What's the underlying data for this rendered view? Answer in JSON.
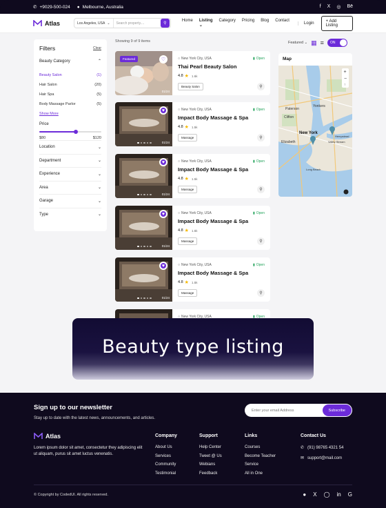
{
  "topbar": {
    "phone": "+9029-500-024",
    "location": "Melbourne, Australia",
    "socials": [
      "f",
      "X",
      "◎",
      "Bē"
    ]
  },
  "nav": {
    "brand": "Atlas",
    "search_location": "Los Angeles, USA",
    "search_placeholder": "Search property....",
    "menu": [
      "Home",
      "Listing",
      "Category",
      "Pricing",
      "Blog",
      "Contact"
    ],
    "login": "Login",
    "add_listing": "Add Listing"
  },
  "filters": {
    "title": "Filters",
    "clear": "Clear",
    "category_title": "Beauty Category",
    "categories": [
      {
        "label": "Beauty Salon",
        "count": "(1)"
      },
      {
        "label": "Hair Salon",
        "count": "(20)"
      },
      {
        "label": "Hair Spa",
        "count": "(5)"
      },
      {
        "label": "Body Massage Parlor",
        "count": "(5)"
      }
    ],
    "show_more": "Show More",
    "price_title": "Price",
    "price_min": "$80",
    "price_max": "$120",
    "price_level": 0.58,
    "sections": [
      "Location",
      "Department",
      "Experience",
      "Area",
      "Garage",
      "Type"
    ]
  },
  "results": {
    "showing": "Showing 9 of 9 items",
    "sort": "Featured",
    "map_toggle": "ON"
  },
  "listings": [
    {
      "featured": "Featured",
      "location": "New York City, USA",
      "status": "Open",
      "name": "Thai Pearl Beauty Salon",
      "rating": "4.8",
      "reviews": "1.6k",
      "tag": "Beauty Salon",
      "counter": "01/24"
    },
    {
      "location": "New York City, USA",
      "status": "Open",
      "name": "Impact Body Massage & Spa",
      "rating": "4.8",
      "reviews": "1.5k",
      "tag": "Massage",
      "counter": "01/24"
    },
    {
      "location": "New York City, USA",
      "status": "Open",
      "name": "Impact Body Massage & Spa",
      "rating": "4.8",
      "reviews": "1.5k",
      "tag": "Massage",
      "counter": "01/24"
    },
    {
      "location": "New York City, USA",
      "status": "Open",
      "name": "Impact Body Massage & Spa",
      "rating": "4.8",
      "reviews": "1.5k",
      "tag": "Massage",
      "counter": "01/24"
    },
    {
      "location": "New York City, USA",
      "status": "Open",
      "name": "Impact Body Massage & Spa",
      "rating": "4.8",
      "reviews": "1.5k",
      "tag": "Massage",
      "counter": "01/24"
    },
    {
      "location": "New York City, USA",
      "status": "Open"
    }
  ],
  "map": {
    "title": "Map",
    "labels": [
      "Paterson",
      "Yonkers",
      "Clifton",
      "New York",
      "Hempstead",
      "Valley Stream",
      "Elizabeth",
      "Long Beach"
    ]
  },
  "banner": {
    "title": "Beauty type listing"
  },
  "footer": {
    "newsletter_title": "Sign up to our newsletter",
    "newsletter_sub": "Stay up to date with the latest news, announcements, and articles.",
    "email_placeholder": "Enter your email Address",
    "subscribe": "Subscribe",
    "brand": "Atlas",
    "about": "Lorem ipsum dolor sit amet, consectetur they adipiscing elit ut aliquam, purus sit amet luctus venenatis.",
    "company": {
      "title": "Company",
      "links": [
        "About Us",
        "Services",
        "Community",
        "Testimonial"
      ]
    },
    "support": {
      "title": "Support",
      "links": [
        "Help Center",
        "Tweet @ Us",
        "Webians",
        "Feedback"
      ]
    },
    "links": {
      "title": "Links",
      "links": [
        "Courses",
        "Become Teacher",
        "Service",
        "All in One"
      ]
    },
    "contact": {
      "title": "Contact Us",
      "phone": "(91) 98765 4321 54",
      "email": "support@mail.com"
    },
    "copyright": "© Copyright by CodedUI. All rights reserved."
  },
  "colors": {
    "accent": "#6c2bd9",
    "dark": "#0f0a1e",
    "open": "#22a35a"
  }
}
